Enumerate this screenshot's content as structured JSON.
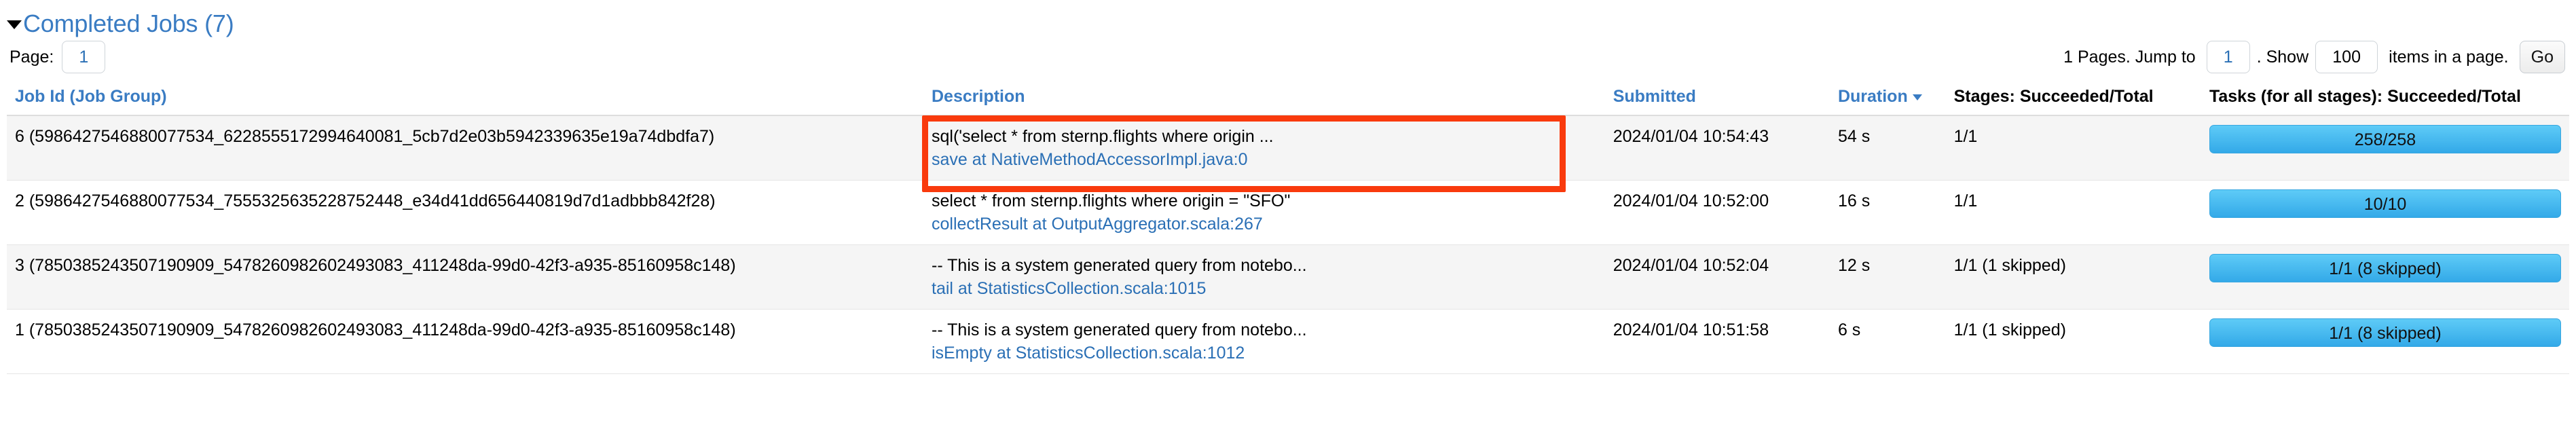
{
  "section": {
    "title": "Completed Jobs (7)",
    "caret_icon": "caret-down-icon",
    "expanded": true
  },
  "pagination": {
    "page_label": "Page:",
    "page_value": "1",
    "pages_count_text": "1 Pages. Jump to",
    "jump_value": "1",
    "show_text": ". Show",
    "show_value": "100",
    "items_text": "items in a page.",
    "go_label": "Go"
  },
  "table": {
    "columns": [
      {
        "key": "job_id",
        "label": "Job Id (Job Group)",
        "link": true,
        "sorted": false
      },
      {
        "key": "description",
        "label": "Description",
        "link": true,
        "sorted": false
      },
      {
        "key": "submitted",
        "label": "Submitted",
        "link": true,
        "sorted": false
      },
      {
        "key": "duration",
        "label": "Duration",
        "link": true,
        "sorted": true
      },
      {
        "key": "stages",
        "label": "Stages: Succeeded/Total",
        "link": false,
        "sorted": false
      },
      {
        "key": "tasks",
        "label": "Tasks (for all stages): Succeeded/Total",
        "link": false,
        "sorted": false
      }
    ],
    "rows": [
      {
        "job_id": "6 (5986427546880077534_6228555172994640081_5cb7d2e03b5942339635e19a74dbdfa7)",
        "description_main": "sql('select * from sternp.flights where origin ...",
        "description_link": "save at NativeMethodAccessorImpl.java:0",
        "submitted": "2024/01/04 10:54:43",
        "duration": "54 s",
        "stages": "1/1",
        "tasks_label": "258/258",
        "tasks_percent": 100,
        "highlighted": true
      },
      {
        "job_id": "2 (5986427546880077534_7555325635228752448_e34d41dd656440819d7d1adbbb842f28)",
        "description_main": "select * from sternp.flights where origin = \"SFO\"",
        "description_link": "collectResult at OutputAggregator.scala:267",
        "submitted": "2024/01/04 10:52:00",
        "duration": "16 s",
        "stages": "1/1",
        "tasks_label": "10/10",
        "tasks_percent": 100,
        "highlighted": false
      },
      {
        "job_id": "3 (7850385243507190909_5478260982602493083_411248da-99d0-42f3-a935-85160958c148)",
        "description_main": "-- This is a system generated query from notebo...",
        "description_link": "tail at StatisticsCollection.scala:1015",
        "submitted": "2024/01/04 10:52:04",
        "duration": "12 s",
        "stages": "1/1 (1 skipped)",
        "tasks_label": "1/1 (8 skipped)",
        "tasks_percent": 100,
        "highlighted": false
      },
      {
        "job_id": "1 (7850385243507190909_5478260982602493083_411248da-99d0-42f3-a935-85160958c148)",
        "description_main": "-- This is a system generated query from notebo...",
        "description_link": "isEmpty at StatisticsCollection.scala:1012",
        "submitted": "2024/01/04 10:51:58",
        "duration": "6 s",
        "stages": "1/1 (1 skipped)",
        "tasks_label": "1/1 (8 skipped)",
        "tasks_percent": 100,
        "highlighted": false
      }
    ]
  },
  "colors": {
    "link": "#2a6fb5",
    "header_link": "#3a7cc3",
    "progress_fill": "#33a9e8",
    "annotation": "#f93a0d",
    "row_alt": "#f5f5f5"
  }
}
